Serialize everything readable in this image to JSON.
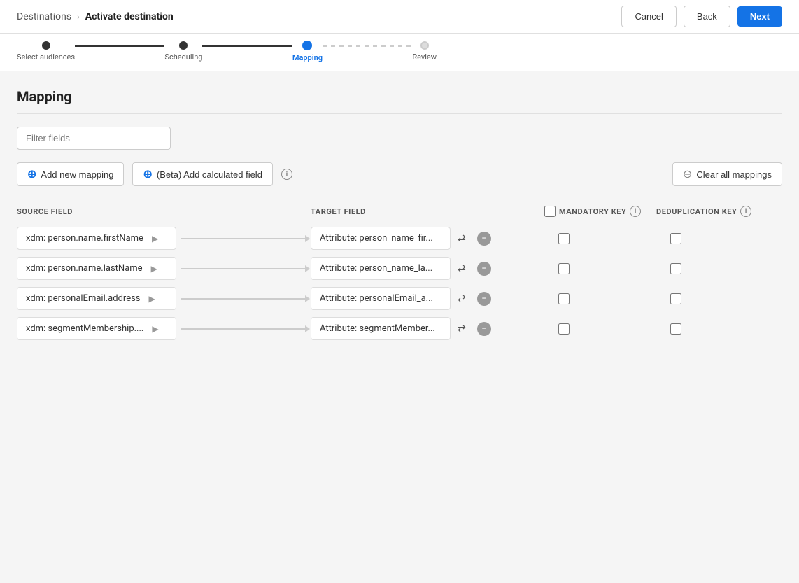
{
  "header": {
    "breadcrumb_parent": "Destinations",
    "breadcrumb_separator": "›",
    "breadcrumb_current": "Activate destination",
    "cancel_label": "Cancel",
    "back_label": "Back",
    "next_label": "Next"
  },
  "progress": {
    "steps": [
      {
        "id": "select-audiences",
        "label": "Select audiences",
        "state": "completed"
      },
      {
        "id": "scheduling",
        "label": "Scheduling",
        "state": "completed"
      },
      {
        "id": "mapping",
        "label": "Mapping",
        "state": "active"
      },
      {
        "id": "review",
        "label": "Review",
        "state": "future"
      }
    ]
  },
  "main": {
    "section_title": "Mapping",
    "filter_placeholder": "Filter fields",
    "add_mapping_label": "Add new mapping",
    "add_calculated_label": "(Beta) Add calculated field",
    "clear_all_label": "Clear all mappings",
    "columns": {
      "source": "SOURCE FIELD",
      "target": "TARGET FIELD",
      "mandatory": "MANDATORY KEY",
      "dedup": "DEDUPLICATION KEY"
    },
    "mappings": [
      {
        "id": 1,
        "source": "xdm: person.name.firstName",
        "target": "Attribute: person_name_fir..."
      },
      {
        "id": 2,
        "source": "xdm: person.name.lastName",
        "target": "Attribute: person_name_la..."
      },
      {
        "id": 3,
        "source": "xdm: personalEmail.address",
        "target": "Attribute: personalEmail_a..."
      },
      {
        "id": 4,
        "source": "xdm: segmentMembership....",
        "target": "Attribute: segmentMember..."
      }
    ]
  }
}
